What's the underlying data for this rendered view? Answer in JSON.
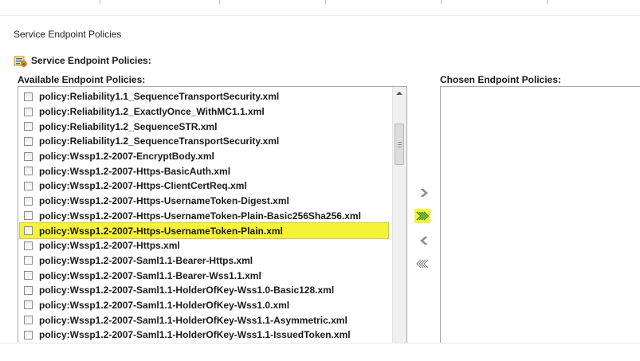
{
  "section": {
    "title": "Service Endpoint Policies"
  },
  "group": {
    "header": "Service Endpoint Policies:",
    "icon": "policy-lock-icon"
  },
  "available": {
    "label": "Available Endpoint Policies:",
    "items": [
      "policy:Reliability1.1_SequenceTransportSecurity.xml",
      "policy:Reliability1.2_ExactlyOnce_WithMC1.1.xml",
      "policy:Reliability1.2_SequenceSTR.xml",
      "policy:Reliability1.2_SequenceTransportSecurity.xml",
      "policy:Wssp1.2-2007-EncryptBody.xml",
      "policy:Wssp1.2-2007-Https-BasicAuth.xml",
      "policy:Wssp1.2-2007-Https-ClientCertReq.xml",
      "policy:Wssp1.2-2007-Https-UsernameToken-Digest.xml",
      "policy:Wssp1.2-2007-Https-UsernameToken-Plain-Basic256Sha256.xml",
      "policy:Wssp1.2-2007-Https-UsernameToken-Plain.xml",
      "policy:Wssp1.2-2007-Https.xml",
      "policy:Wssp1.2-2007-Saml1.1-Bearer-Https.xml",
      "policy:Wssp1.2-2007-Saml1.1-Bearer-Wss1.1.xml",
      "policy:Wssp1.2-2007-Saml1.1-HolderOfKey-Wss1.0-Basic128.xml",
      "policy:Wssp1.2-2007-Saml1.1-HolderOfKey-Wss1.0.xml",
      "policy:Wssp1.2-2007-Saml1.1-HolderOfKey-Wss1.1-Asymmetric.xml",
      "policy:Wssp1.2-2007-Saml1.1-HolderOfKey-Wss1.1-IssuedToken.xml"
    ],
    "selected_index": 9
  },
  "chosen": {
    "label": "Chosen Endpoint Policies:",
    "items": []
  },
  "shuttle": {
    "move_right": "›",
    "move_all_right": "»",
    "move_left": "‹",
    "move_all_left": "«"
  },
  "colors": {
    "highlight": "#f6f338",
    "arrow": "#8a8a8a",
    "arrow_active": "#2e8b2e"
  }
}
